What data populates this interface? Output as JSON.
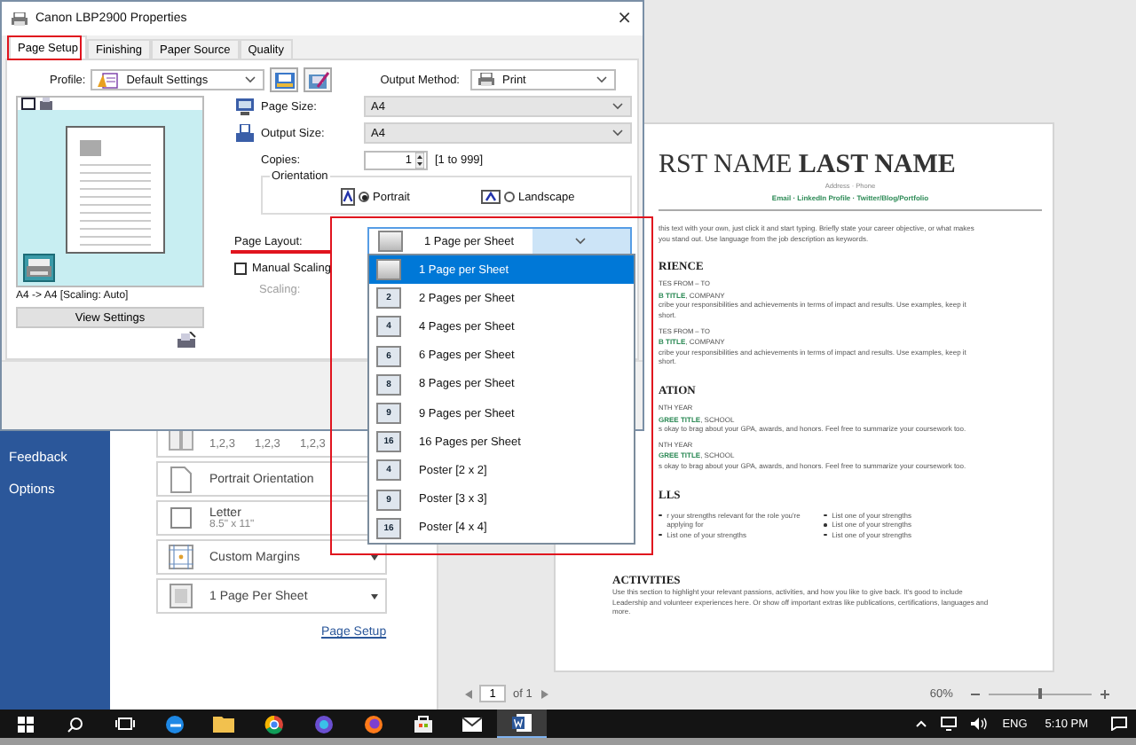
{
  "dialog": {
    "title": "Canon LBP2900 Properties",
    "close": "×",
    "tabs": [
      {
        "label": "Page Setup",
        "selected": true
      },
      {
        "label": "Finishing",
        "selected": false
      },
      {
        "label": "Paper Source",
        "selected": false
      },
      {
        "label": "Quality",
        "selected": false
      }
    ],
    "profile": {
      "label": "Profile:",
      "value": "Default Settings"
    },
    "output_method": {
      "label": "Output Method:",
      "value": "Print"
    },
    "preview": {
      "caption": "A4 -> A4 [Scaling: Auto]",
      "button": "View Settings"
    },
    "fields": [
      {
        "label": "Page Size:",
        "value": "A4"
      },
      {
        "label": "Output Size:",
        "value": "A4"
      }
    ],
    "copies": {
      "label": "Copies:",
      "value": "1",
      "range": "[1 to 999]"
    },
    "orientation": {
      "label": "Orientation",
      "options": [
        {
          "label": "Portrait",
          "selected": true
        },
        {
          "label": "Landscape",
          "selected": false
        }
      ]
    },
    "page_layout": {
      "label": "Page Layout:",
      "value": "1 Page per Sheet",
      "expanded": true,
      "options": [
        {
          "label": "1 Page per Sheet",
          "selected": true
        },
        {
          "label": "2 Pages per Sheet",
          "icon_text": "2",
          "selected": false
        },
        {
          "label": "4 Pages per Sheet",
          "icon_text": "4",
          "selected": false
        },
        {
          "label": "6 Pages per Sheet",
          "icon_text": "6",
          "selected": false
        },
        {
          "label": "8 Pages per Sheet",
          "icon_text": "8",
          "selected": false
        },
        {
          "label": "9 Pages per Sheet",
          "icon_text": "9",
          "selected": false
        },
        {
          "label": "16 Pages per Sheet",
          "icon_text": "16",
          "selected": false
        },
        {
          "label": "Poster [2 x 2]",
          "icon_text": "4",
          "selected": false
        },
        {
          "label": "Poster [3 x 3]",
          "icon_text": "9",
          "selected": false
        },
        {
          "label": "Poster [4 x 4]",
          "icon_text": "16",
          "selected": false
        }
      ]
    },
    "manual_scaling": {
      "label": "Manual Scaling",
      "checked": false
    },
    "scaling": {
      "label": "Scaling:",
      "disabled": true
    }
  },
  "word": {
    "sidebar": [
      "Feedback",
      "Options"
    ],
    "settings": [
      {
        "kind": "collate",
        "values": [
          "1,2,3",
          "1,2,3",
          "1,2,3"
        ]
      },
      {
        "kind": "option",
        "title": "Portrait Orientation"
      },
      {
        "kind": "option",
        "title": "Letter",
        "subtitle": "8.5\" x 11\""
      },
      {
        "kind": "option",
        "title": "Custom Margins"
      },
      {
        "kind": "option",
        "title": "1 Page Per Sheet"
      }
    ],
    "page_setup_link": "Page Setup",
    "document": {
      "name_first": "RST NAME",
      "name_last": "LAST NAME",
      "address": "Address · Phone",
      "contact": "Email · LinkedIn Profile · Twitter/Blog/Portfolio",
      "intro": "this text with your own, just click it and start typing. Briefly state your career objective, or what makes you stand out. Use language from the job description as keywords.",
      "sections": [
        {
          "kind": "entries",
          "heading": "RIENCE",
          "entries": [
            {
              "date": "TES FROM – TO",
              "title": "**B TITLE**, COMPANY",
              "text": "cribe your responsibilities and achievements in terms of impact and results. Use examples, keep it short."
            },
            {
              "date": "TES FROM – TO",
              "title": "**B TITLE**, COMPANY",
              "text": "cribe your responsibilities and achievements in terms of impact and results. Use examples, keep it short."
            }
          ]
        },
        {
          "kind": "entries",
          "heading": "ATION",
          "entries": [
            {
              "date": "NTH YEAR",
              "title": "**GREE TITLE**, SCHOOL",
              "text": "s okay to brag about your GPA, awards, and honors. Feel free to summarize your coursework too."
            },
            {
              "date": "NTH YEAR",
              "title": "**GREE TITLE**, SCHOOL",
              "text": "s okay to brag about your GPA, awards, and honors. Feel free to summarize your coursework too."
            }
          ]
        },
        {
          "kind": "lists",
          "heading": "LLS",
          "columns": [
            [
              "r your strengths relevant for the role you're applying for",
              "List one of your strengths"
            ],
            [
              "List one of your strengths",
              "List one of your strengths",
              "List one of your strengths"
            ]
          ]
        }
      ],
      "activities": {
        "heading": "ACTIVITIES",
        "text": "Use this section to highlight your relevant passions, activities, and how you like to give back. It's good to include Leadership and volunteer experiences here. Or show off important extras like publications, certifications, languages and more."
      }
    },
    "page_nav": {
      "page": "1",
      "total": "of 1"
    },
    "zoom": {
      "label": "60%",
      "level": 0.5
    }
  },
  "taskbar": {
    "apps": [
      {
        "selected": false
      },
      {
        "selected": false
      },
      {
        "selected": false
      },
      {
        "selected": false
      },
      {
        "selected": false
      },
      {
        "selected": false
      },
      {
        "selected": false
      },
      {
        "selected": true
      }
    ],
    "language": "ENG",
    "time": "5:10 PM"
  }
}
